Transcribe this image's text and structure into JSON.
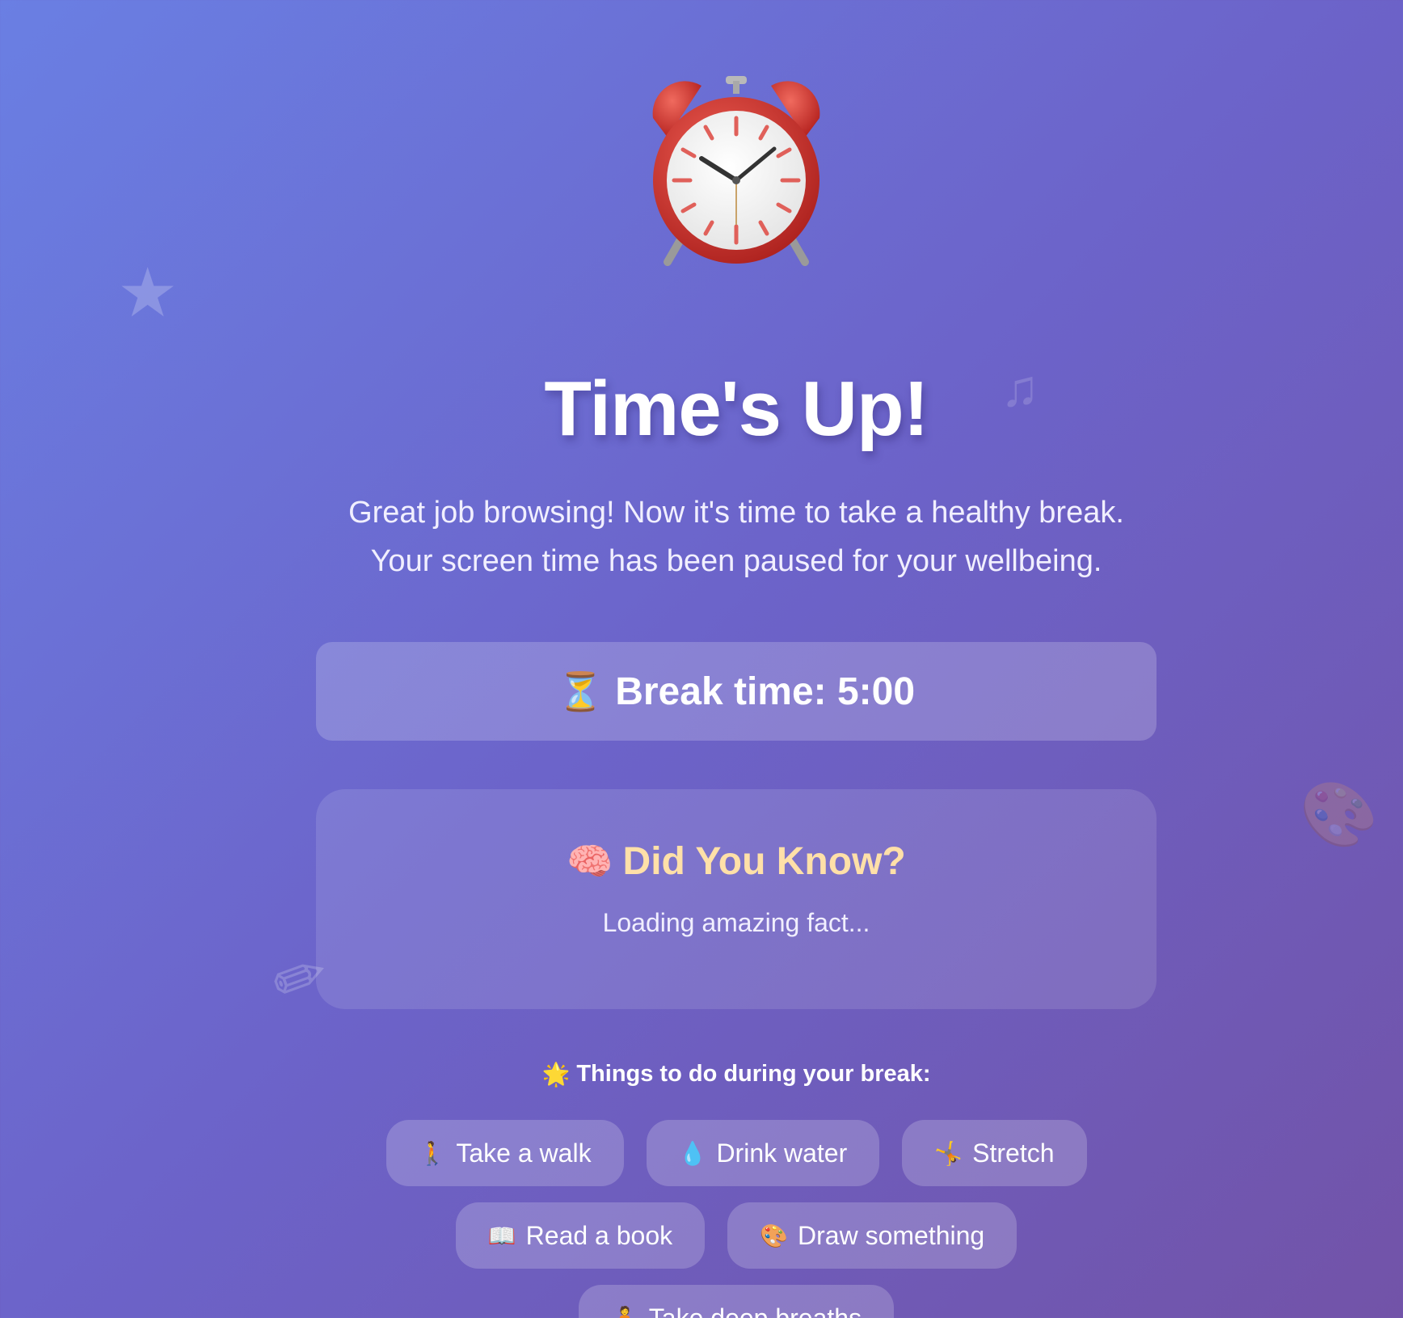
{
  "page": {
    "title": "Time's Up!",
    "subtitle_line1": "Great job browsing! Now it's time to take a healthy break.",
    "subtitle_line2": "Your screen time has been paused for your wellbeing."
  },
  "timer": {
    "icon": "hourglass-icon",
    "label": "Break time: 5:00"
  },
  "fact": {
    "icon": "brain-icon",
    "title": "Did You Know?",
    "text": "Loading amazing fact..."
  },
  "activities": {
    "heading_icon": "sparkle-icon",
    "heading": "Things to do during your break:",
    "items": [
      {
        "icon": "walking-person-icon",
        "label": "Take a walk"
      },
      {
        "icon": "water-drop-icon",
        "label": "Drink water"
      },
      {
        "icon": "cartwheel-icon",
        "label": "Stretch"
      },
      {
        "icon": "open-book-icon",
        "label": "Read a book"
      },
      {
        "icon": "palette-icon",
        "label": "Draw something"
      },
      {
        "icon": "meditation-icon",
        "label": "Take deep breaths"
      }
    ]
  },
  "colors": {
    "background_start": "#6a7fe3",
    "background_end": "#7253a8",
    "fact_title": "#ffe0a8",
    "clock_red": "#d9302c"
  }
}
